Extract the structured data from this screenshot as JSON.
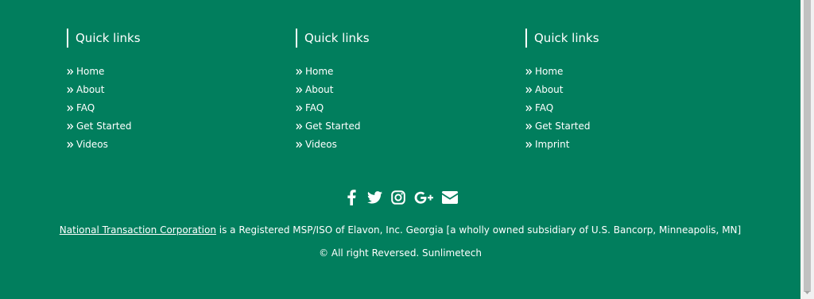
{
  "columns": [
    {
      "title": "Quick links",
      "links": [
        "Home",
        "About",
        "FAQ",
        "Get Started",
        "Videos"
      ]
    },
    {
      "title": "Quick links",
      "links": [
        "Home",
        "About",
        "FAQ",
        "Get Started",
        "Videos"
      ]
    },
    {
      "title": "Quick links",
      "links": [
        "Home",
        "About",
        "FAQ",
        "Get Started",
        "Imprint"
      ]
    }
  ],
  "social": [
    "facebook-icon",
    "twitter-icon",
    "instagram-icon",
    "google-plus-icon",
    "email-icon"
  ],
  "notice": {
    "link": "National Transaction Corporation",
    "text": " is a Registered MSP/ISO of Elavon, Inc. Georgia [a wholly owned subsidiary of U.S. Bancorp, Minneapolis, MN]"
  },
  "copyright": "© All right Reversed.  Sunlimetech",
  "colors": {
    "footer_bg": "#017e5d",
    "text": "#ffffff",
    "scrollbar_thumb": "#c1c1c1"
  }
}
